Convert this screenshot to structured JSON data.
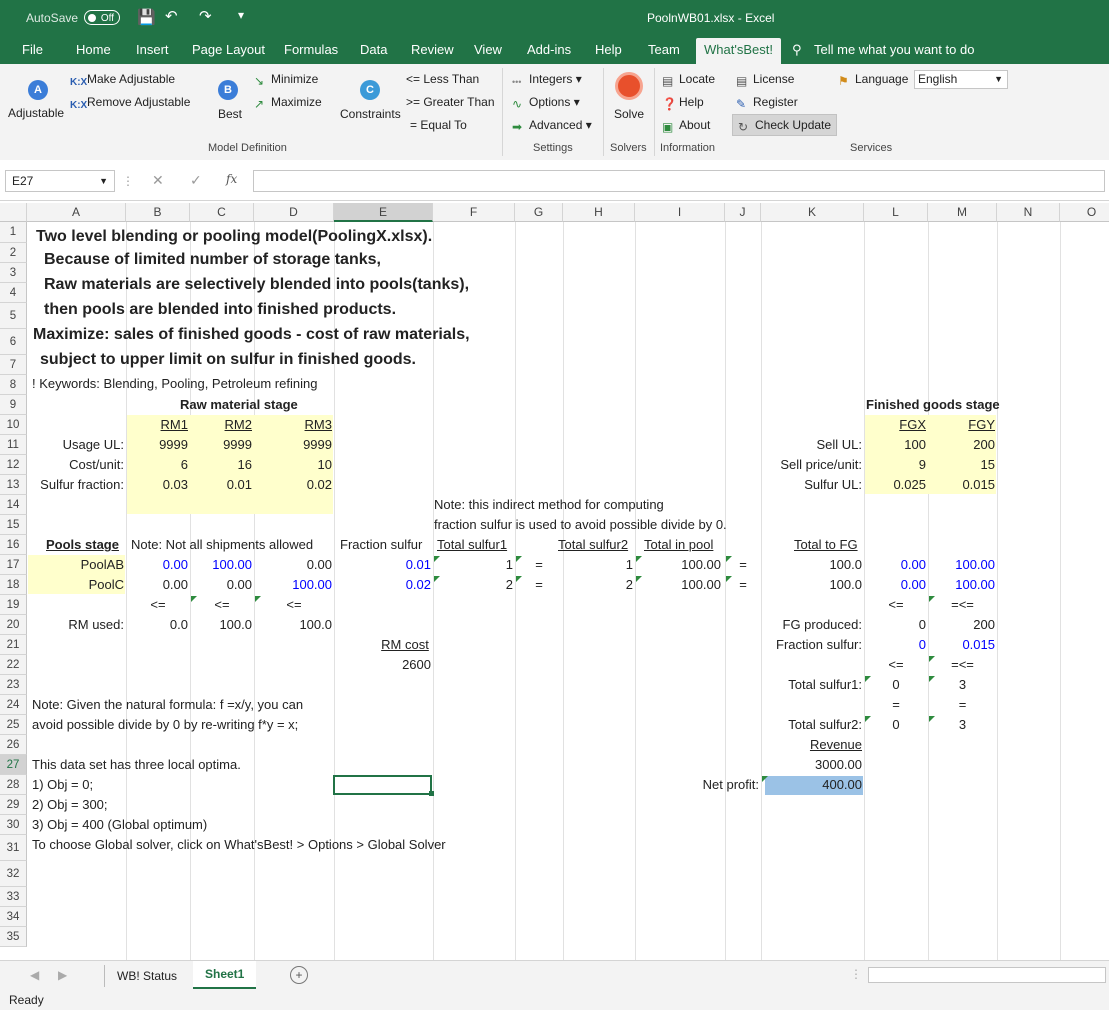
{
  "titlebar": {
    "autosave": "AutoSave",
    "autosave_state": "Off",
    "filename": "PoolnWB01.xlsx",
    "separator": "-",
    "app": "Excel"
  },
  "tabs": [
    "File",
    "Home",
    "Insert",
    "Page Layout",
    "Formulas",
    "Data",
    "Review",
    "View",
    "Add-ins",
    "Help",
    "Team",
    "What'sBest!",
    "Tell me what you want to do"
  ],
  "ribbon": {
    "adjustable": "Adjustable",
    "make_adjustable": "Make Adjustable",
    "remove_adjustable": "Remove Adjustable",
    "best": "Best",
    "minimize": "Minimize",
    "maximize": "Maximize",
    "constraints": "Constraints",
    "less_than": "<= Less Than",
    "greater_than": ">= Greater Than",
    "equal_to": "= Equal To",
    "integers": "Integers",
    "options": "Options",
    "advanced": "Advanced",
    "solve": "Solve",
    "locate": "Locate",
    "help": "Help",
    "about": "About",
    "license": "License",
    "register": "Register",
    "check_update": "Check Update",
    "language": "Language",
    "language_value": "English",
    "groups": {
      "model_definition": "Model Definition",
      "settings": "Settings",
      "solvers": "Solvers",
      "information": "Information",
      "services": "Services"
    }
  },
  "formula_bar": {
    "name_box": "E27",
    "fx": "fx",
    "formula": ""
  },
  "columns": [
    "A",
    "B",
    "C",
    "D",
    "E",
    "F",
    "G",
    "H",
    "I",
    "J",
    "K",
    "L",
    "M",
    "N",
    "O"
  ],
  "rows": [
    "1",
    "2",
    "3",
    "4",
    "5",
    "6",
    "7",
    "8",
    "9",
    "10",
    "11",
    "12",
    "13",
    "14",
    "15",
    "16",
    "17",
    "18",
    "19",
    "20",
    "21",
    "22",
    "23",
    "24",
    "25",
    "26",
    "27",
    "28",
    "29",
    "30",
    "31",
    "32",
    "33",
    "34",
    "35"
  ],
  "sheet": {
    "r1": "Two level blending or pooling model(PoolingX.xlsx).",
    "r2": "Because of limited number of storage tanks,",
    "r3": "Raw materials are selectively blended into pools(tanks),",
    "r4": "then pools are blended into finished products.",
    "r5": "Maximize: sales of finished goods - cost of raw materials,",
    "r6": "subject to upper limit on sulfur in finished goods.",
    "r7": "! Keywords: Blending, Pooling, Petroleum refining",
    "raw_stage": "Raw material stage",
    "fg_stage": "Finished goods stage",
    "rm1": "RM1",
    "rm2": "RM2",
    "rm3": "RM3",
    "fgx": "FGX",
    "fgy": "FGY",
    "usage_ul": "Usage UL:",
    "cost_unit": "Cost/unit:",
    "sulfur_fraction": "Sulfur fraction:",
    "usage_vals": [
      "9999",
      "9999",
      "9999"
    ],
    "cost_vals": [
      "6",
      "16",
      "10"
    ],
    "sulfur_vals": [
      "0.03",
      "0.01",
      "0.02"
    ],
    "sell_ul": "Sell UL:",
    "sell_price": "Sell price/unit:",
    "sulfur_ul": "Sulfur UL:",
    "sell_ul_vals": [
      "100",
      "200"
    ],
    "sell_price_vals": [
      "9",
      "15"
    ],
    "sulfur_ul_vals": [
      "0.025",
      "0.015"
    ],
    "note13": "Note: this indirect method for computing",
    "note14": "fraction sulfur is used to avoid possible divide by 0.",
    "pools_stage": "Pools stage",
    "note_ship": "Note: Not all shipments allowed",
    "fraction_sulfur": "Fraction sulfur",
    "total_sulfur1": "Total sulfur1",
    "total_sulfur2": "Total sulfur2",
    "total_in_pool": "Total in pool",
    "total_to_fg": "Total to FG",
    "poolab": "PoolAB",
    "poolc": "PoolC",
    "poolab_vals": [
      "0.00",
      "100.00",
      "0.00",
      "0.01",
      "1",
      "=",
      "1",
      "100.00",
      "=",
      "100.0",
      "0.00",
      "100.00"
    ],
    "poolc_vals": [
      "0.00",
      "0.00",
      "100.00",
      "0.02",
      "2",
      "=",
      "2",
      "100.00",
      "=",
      "100.0",
      "0.00",
      "100.00"
    ],
    "le": "<=",
    "lele": "=<=",
    "eq": "=",
    "rm_used": "RM used:",
    "rm_used_vals": [
      "0.0",
      "100.0",
      "100.0"
    ],
    "fg_produced": "FG produced:",
    "fg_produced_vals": [
      "0",
      "200"
    ],
    "fraction_sulfur_lbl": "Fraction sulfur:",
    "fraction_sulfur_vals": [
      "0",
      "0.015"
    ],
    "rm_cost": "RM cost",
    "rm_cost_val": "2600",
    "total_sulfur1_lbl": "Total sulfur1:",
    "total_sulfur1_vals": [
      "0",
      "3"
    ],
    "total_sulfur2_lbl": "Total sulfur2:",
    "total_sulfur2_vals": [
      "0",
      "3"
    ],
    "note23": "Note: Given the natural formula:  f =x/y, you can",
    "note24": "avoid possible divide by 0 by re-writing f*y = x;",
    "revenue": "Revenue",
    "revenue_val": "3000.00",
    "r26": "This data set has three local optima.",
    "r27": "1) Obj = 0;",
    "net_profit": "Net profit:",
    "net_profit_val": "400.00",
    "r28": "2) Obj = 300;",
    "r29": "3) Obj = 400 (Global optimum)",
    "r30": "To choose Global solver, click on What'sBest! > Options > Global Solver"
  },
  "sheet_tabs": [
    "WB! Status",
    "Sheet1"
  ],
  "status": "Ready",
  "colors": {
    "excel_green": "#217346",
    "input_yellow": "#ffffcc",
    "highlight_blue": "#9bc2e6",
    "value_blue": "#0000ff"
  }
}
